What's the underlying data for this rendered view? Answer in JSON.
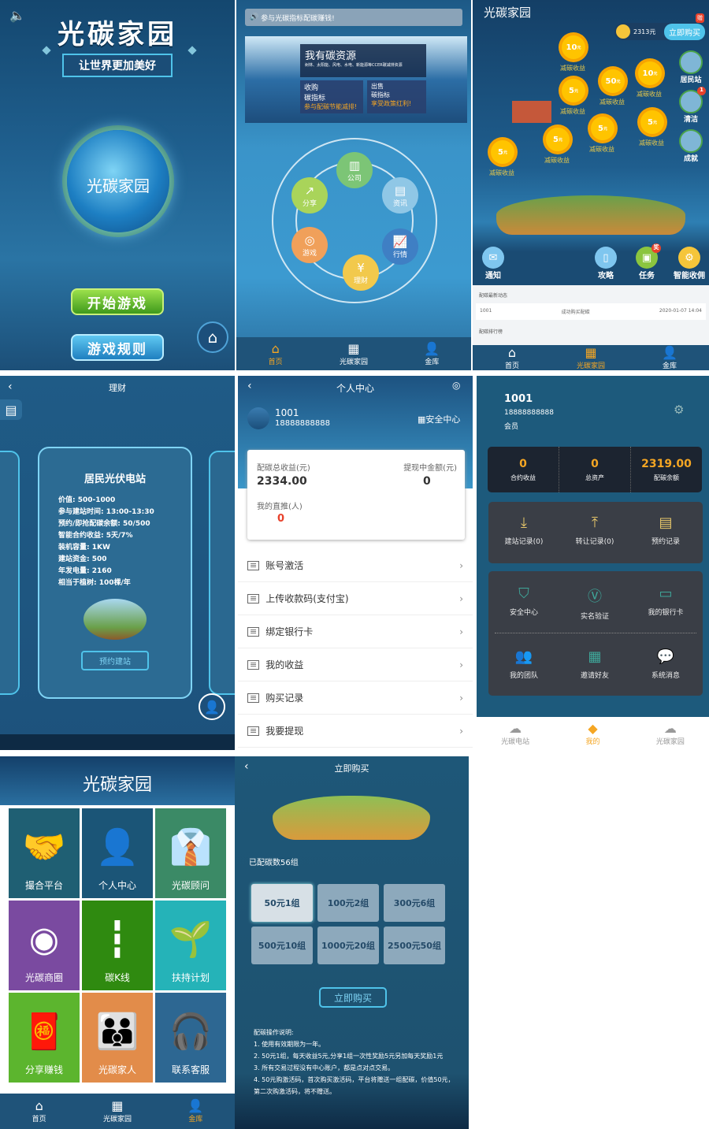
{
  "colors": {
    "accent": "#f5a623",
    "navy": "#1f5379",
    "red": "#e8412b"
  },
  "tabs_main": [
    {
      "label": "首页",
      "icon": "home-icon"
    },
    {
      "label": "光碳家园",
      "icon": "apps-icon"
    },
    {
      "label": "金库",
      "icon": "user-icon"
    }
  ],
  "splash": {
    "title": "光碳家园",
    "slogan": "让世界更加美好",
    "globe_text": "光碳家园",
    "start": "开始游戏",
    "rules": "游戏规则"
  },
  "home": {
    "notice": "参与光碳指标配碳赚钱!",
    "banner": {
      "title": "我有碳资源",
      "subtitle": "树林、太阳能、风电、水电、新能源等CCER碳减排资源",
      "buy_title": "收购",
      "buy_sub": "碳指标",
      "buy_slogan": "参与配碳节能减排!",
      "sell_title": "出售",
      "sell_sub": "碳指标",
      "sell_slogan": "享受政策红利!"
    },
    "ring": [
      {
        "label": "公司",
        "icon": "building-icon",
        "color": "#7cc576"
      },
      {
        "label": "资讯",
        "icon": "news-icon",
        "color": "#8fc7e6"
      },
      {
        "label": "行情",
        "icon": "chart-icon",
        "color": "#3f7fc4"
      },
      {
        "label": "理财",
        "icon": "money-bag-icon",
        "color": "#f2c94c"
      },
      {
        "label": "游戏",
        "icon": "target-icon",
        "color": "#f0a05a"
      },
      {
        "label": "分享",
        "icon": "share-icon",
        "color": "#a9d45a"
      }
    ],
    "active_tab": 0
  },
  "game": {
    "logo": "光碳家园",
    "balance": "2313元",
    "buy": "立即购买",
    "buy_badge": "赠",
    "suns": [
      {
        "v": "10"
      },
      {
        "v": "5"
      },
      {
        "v": "50"
      },
      {
        "v": "10"
      },
      {
        "v": "5"
      },
      {
        "v": "5"
      },
      {
        "v": "5"
      },
      {
        "v": "5"
      }
    ],
    "sun_unit": "元",
    "sun_label": "减碳收益",
    "side": [
      {
        "label": "居民站"
      },
      {
        "label": "清洁",
        "badge": "1"
      },
      {
        "label": "成就"
      }
    ],
    "icons": [
      {
        "label": "通知",
        "icon": "mail-icon"
      },
      {
        "label": "攻略",
        "icon": "book-icon"
      },
      {
        "label": "任务",
        "icon": "task-icon",
        "badge": "奖"
      },
      {
        "label": "智能收佣",
        "icon": "robot-icon"
      }
    ],
    "feed_title": "配碳最新动态",
    "feed": [
      {
        "user": "1001",
        "action": "成功购买配碳",
        "time": "2020-01-07 14:04"
      }
    ],
    "rank_title": "配碳排行榜",
    "active_tab": 1
  },
  "licai": {
    "title": "理财",
    "card_title": "居民光伏电站",
    "rows": [
      "价值: 500-1000",
      "参与建站时间: 13:00-13:30",
      "预约/即抢配碳余额: 50/500",
      "智能合约收益: 5天/7%",
      "装机容量: 1KW",
      "建站资金: 500",
      "年发电量: 2160",
      "相当于植树: 100棵/年"
    ],
    "reserve": "预约建站"
  },
  "profile": {
    "title": "个人中心",
    "user": "1001",
    "phone": "18888888888",
    "security": "安全中心",
    "total_label": "配碳总收益(元)",
    "total": "2334.00",
    "withdraw_label": "提现中金额(元)",
    "withdraw": "0",
    "refer_label": "我的直推(人)",
    "refer": "0",
    "menu": [
      "账号激活",
      "上传收款码(支付宝)",
      "绑定银行卡",
      "我的收益",
      "购买记录",
      "我要提现"
    ]
  },
  "mine": {
    "user": "1001",
    "phone": "18888888888",
    "role": "会员",
    "stats": [
      {
        "v": "0",
        "l": "合约收益"
      },
      {
        "v": "0",
        "l": "总资产"
      },
      {
        "v": "2319.00",
        "l": "配碳余额"
      }
    ],
    "records": [
      {
        "l": "建站记录(0)",
        "icon": "money-bag-down-icon"
      },
      {
        "l": "转让记录(0)",
        "icon": "money-bag-up-icon"
      },
      {
        "l": "预约记录",
        "icon": "document-icon"
      }
    ],
    "grid": [
      {
        "l": "安全中心",
        "icon": "shield-icon"
      },
      {
        "l": "实名验证",
        "icon": "verify-icon"
      },
      {
        "l": "我的银行卡",
        "icon": "card-icon"
      },
      {
        "l": "我的团队",
        "icon": "team-icon"
      },
      {
        "l": "邀请好友",
        "icon": "qr-icon"
      },
      {
        "l": "系统消息",
        "icon": "message-icon"
      }
    ],
    "tabs": [
      {
        "label": "光碳电站"
      },
      {
        "label": "我的"
      },
      {
        "label": "光碳家园"
      }
    ],
    "active_tab": 1
  },
  "vault": {
    "logo": "光碳家园",
    "tiles": [
      {
        "l": "撮合平台",
        "icon": "handshake-icon",
        "color": "#1f5f73"
      },
      {
        "l": "个人中心",
        "icon": "add-user-icon",
        "color": "#1b5577"
      },
      {
        "l": "光碳顾问",
        "icon": "advisor-icon",
        "color": "#3b8a66"
      },
      {
        "l": "光碳商圈",
        "icon": "aperture-icon",
        "color": "#7a4aa0"
      },
      {
        "l": "碳K线",
        "icon": "candlestick-icon",
        "color": "#2f8a10"
      },
      {
        "l": "扶持计划",
        "icon": "sprout-icon",
        "color": "#25b3b8"
      },
      {
        "l": "分享赚钱",
        "icon": "red-envelope-icon",
        "color": "#5cb52e"
      },
      {
        "l": "光碳家人",
        "icon": "group-icon",
        "color": "#e28c4a"
      },
      {
        "l": "联系客服",
        "icon": "headset-icon",
        "color": "#2d6792"
      }
    ],
    "active_tab": 2
  },
  "buy": {
    "title": "立即购买",
    "count": "已配碳数56组",
    "packages": [
      "50元1组",
      "100元2组",
      "300元6组",
      "500元10组",
      "1000元20组",
      "2500元50组"
    ],
    "selected": 0,
    "button": "立即购买",
    "notes_title": "配碳操作说明:",
    "notes": [
      "1. 使用有效期限为一年。",
      "2. 50元1组，每天收益5元,分享1组一次性奖励5元另加每天奖励1元",
      "3. 所有交易过程没有中心账户，都是点对点交易。",
      "4. 50元购激活码，首次购买激活码，平台将赠送一组配碳，价值50元，第二次购激活码，将不赠送。"
    ]
  }
}
